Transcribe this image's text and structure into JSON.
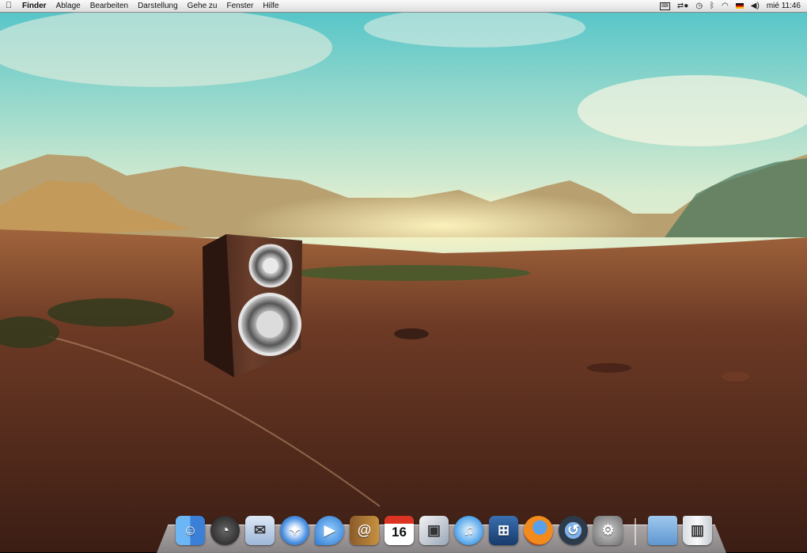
{
  "menubar": {
    "apple_icon": "apple-icon",
    "app_name": "Finder",
    "menus": [
      "Ablage",
      "Bearbeiten",
      "Darstellung",
      "Gehe zu",
      "Fenster",
      "Hilfe"
    ],
    "status_icons": [
      "keyboard-icon",
      "sync-icon",
      "time-machine-icon",
      "bluetooth-icon",
      "wifi-icon",
      "flag-de-icon",
      "volume-icon"
    ],
    "clock": "mié 11:46"
  },
  "dock": {
    "items": [
      {
        "name": "finder",
        "icon": "finder-icon"
      },
      {
        "name": "dashboard",
        "icon": "dashboard-icon"
      },
      {
        "name": "mail",
        "icon": "mail-icon"
      },
      {
        "name": "safari",
        "icon": "safari-icon"
      },
      {
        "name": "ichat",
        "icon": "ichat-icon"
      },
      {
        "name": "address-book",
        "icon": "address-book-icon"
      },
      {
        "name": "ical",
        "icon": "calendar-icon",
        "day": "16"
      },
      {
        "name": "iphoto",
        "icon": "iphoto-icon"
      },
      {
        "name": "itunes",
        "icon": "itunes-icon"
      },
      {
        "name": "spaces",
        "icon": "spaces-icon"
      },
      {
        "name": "firefox",
        "icon": "firefox-icon"
      },
      {
        "name": "time-machine",
        "icon": "time-machine-icon"
      },
      {
        "name": "system-preferences",
        "icon": "gear-icon"
      },
      {
        "name": "documents-folder",
        "icon": "folder-icon"
      },
      {
        "name": "trash",
        "icon": "trash-icon"
      }
    ]
  },
  "colors": {
    "sky_top": "#4fc3c8",
    "sky_haze": "#f3ecc2",
    "ground": "#5a2f1f",
    "mountains": "#b8a070",
    "speaker_wood": "#5a3324"
  }
}
